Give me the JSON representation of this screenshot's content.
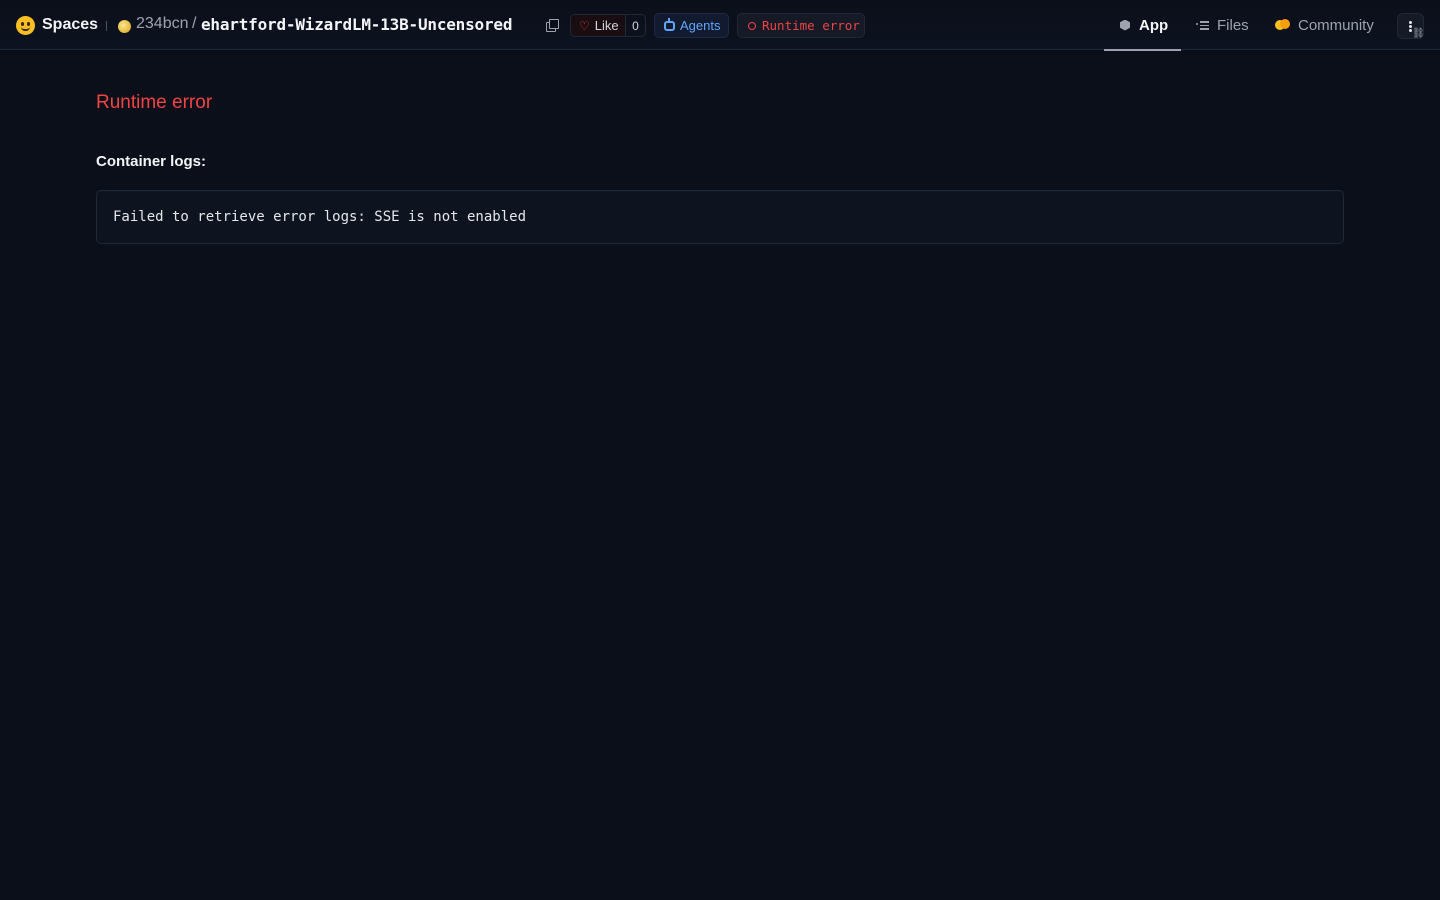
{
  "header": {
    "brand_label": "Spaces",
    "owner": "234bcn",
    "separator": "/",
    "repo_name": "ehartford-WizardLM-13B-Uncensored",
    "like_label": "Like",
    "like_count": "0",
    "agents_label": "Agents",
    "status_label": "Runtime error",
    "tabs": [
      {
        "label": "App",
        "active": true,
        "icon": "cube-icon"
      },
      {
        "label": "Files",
        "active": false,
        "icon": "files-icon"
      },
      {
        "label": "Community",
        "active": false,
        "icon": "community-icon"
      }
    ]
  },
  "main": {
    "error_title": "Runtime error",
    "logs_label": "Container logs:",
    "log_text": "Failed to retrieve error logs: SSE is not enabled"
  },
  "colors": {
    "background": "#0b0f19",
    "error": "#ef4444",
    "accent_blue": "#60a5fa"
  }
}
